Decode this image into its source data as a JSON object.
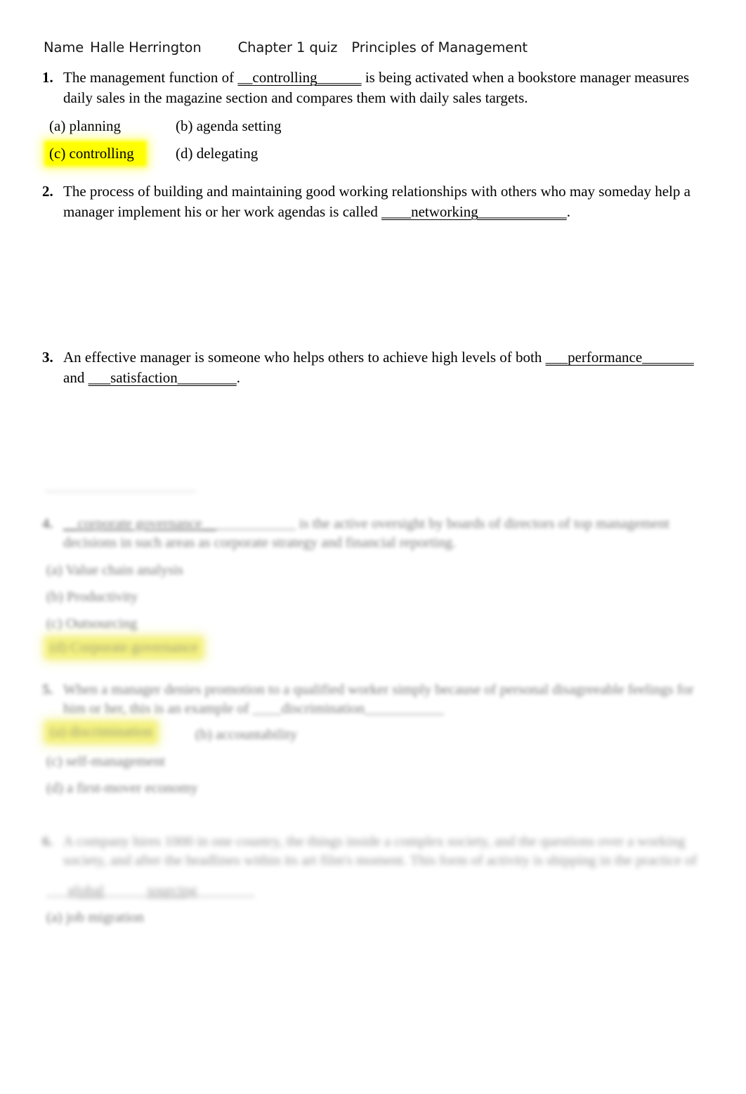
{
  "document": {
    "title": "Chapter 1 quiz — Principles of Management",
    "background_color": "#ffffff",
    "highlight_color": "#ffff00"
  },
  "header": {
    "name_label": "Name",
    "student_name": "Halle Herrington",
    "quiz_title": "Chapter 1 quiz",
    "course": "Principles of Management"
  },
  "questions": [
    {
      "number": "1.",
      "text_before": "The management function of ",
      "answer": "__controlling______",
      "text_after": " is being activated when a bookstore manager measures daily sales in the magazine section and compares them with daily sales targets.",
      "options": [
        {
          "label": "(a) planning",
          "highlighted": false
        },
        {
          "label": "(b) agenda setting",
          "highlighted": false
        },
        {
          "label": "(c) controlling",
          "highlighted": true
        },
        {
          "label": "(d) delegating",
          "highlighted": false
        }
      ]
    },
    {
      "number": "2.",
      "text_before": "The process of building and maintaining good working relationships with others who may someday help a manager implement his or her work agendas is called ",
      "answer": "____networking____________",
      "text_after": ".",
      "options": []
    },
    {
      "number": "3.",
      "text_before": "An effective manager is someone who helps others to achieve high levels of both ",
      "answer": "___performance_______",
      "text_middle": " and ",
      "answer2": "___satisfaction________",
      "text_after": ".",
      "options": []
    }
  ],
  "blurred_section": {
    "note": "lower portion of page is blurred and illegible",
    "divider_visible": true,
    "blocks": [
      {
        "number": "4.",
        "line_count": 2,
        "legible": false,
        "options": [
          {
            "highlighted": false
          },
          {
            "highlighted": false
          },
          {
            "highlighted": false
          },
          {
            "highlighted": true
          }
        ]
      },
      {
        "number": "5.",
        "line_count": 2,
        "legible": false,
        "options": [
          {
            "highlighted": true
          },
          {
            "highlighted": false
          },
          {
            "highlighted": false
          },
          {
            "highlighted": false
          }
        ]
      },
      {
        "number": "6.",
        "line_count": 2,
        "legible": false,
        "options": [
          {
            "highlighted": false
          }
        ]
      }
    ]
  }
}
